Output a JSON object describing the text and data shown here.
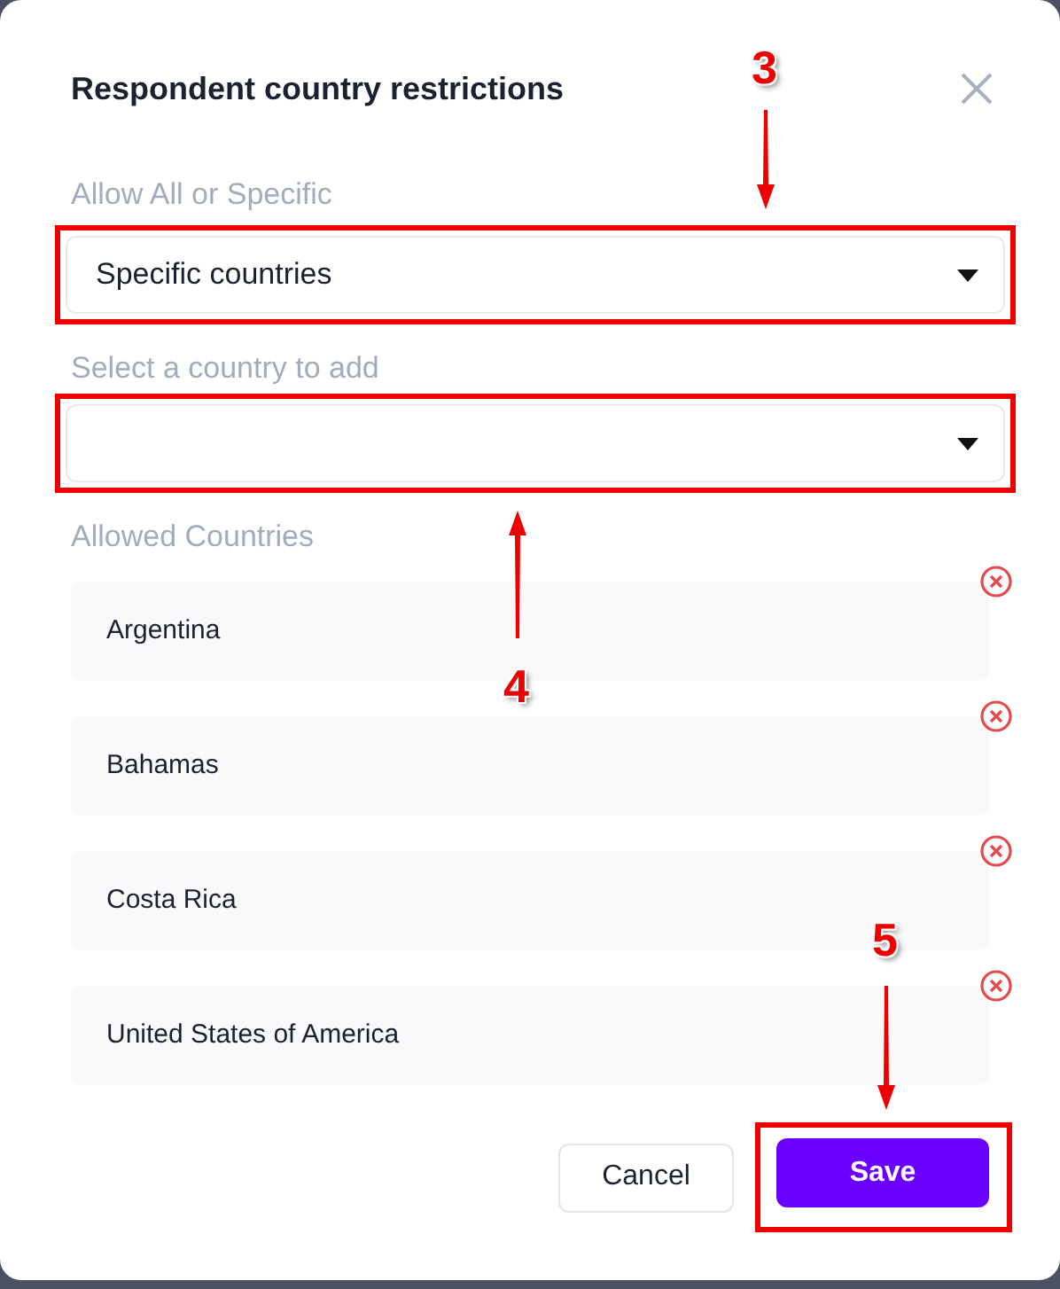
{
  "dialog": {
    "title": "Respondent country restrictions"
  },
  "fields": [
    {
      "label": "Allow All or Specific",
      "value": "Specific countries",
      "highlighted": true
    },
    {
      "label": "Select a country to add",
      "highlighted": true
    }
  ],
  "allowed_countries": {
    "label": "Allowed Countries",
    "items": [
      {
        "name": "Argentina"
      },
      {
        "name": "Bahamas"
      },
      {
        "name": "Costa Rica"
      },
      {
        "name": "United States of America"
      }
    ]
  },
  "buttons": [
    {
      "label": "Cancel",
      "kind": "secondary",
      "highlighted": false
    },
    {
      "label": "Save",
      "kind": "primary",
      "highlighted": true
    }
  ],
  "annotations": [
    {
      "label": "3",
      "kind": "down"
    },
    {
      "label": "4",
      "kind": "up"
    },
    {
      "label": "5",
      "kind": "down"
    }
  ]
}
